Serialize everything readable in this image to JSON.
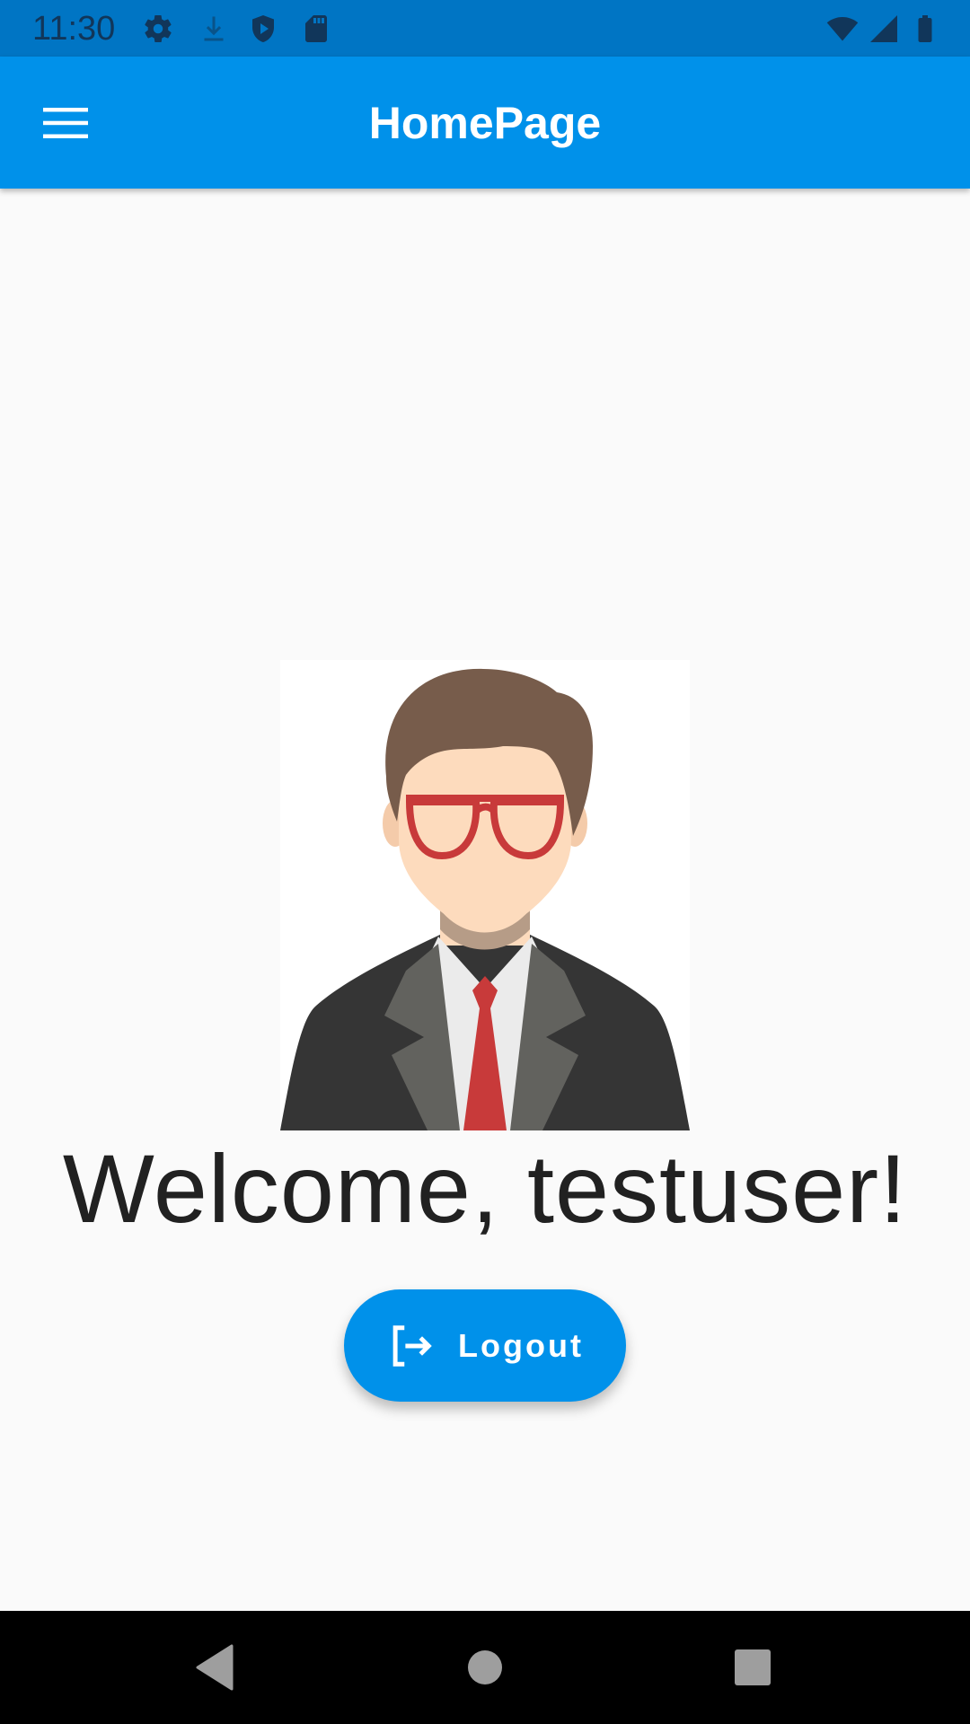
{
  "status_bar": {
    "time": "11:30",
    "left_icons": [
      "gear-icon",
      "download-icon",
      "shield-play-icon",
      "sd-card-icon"
    ],
    "right_icons": [
      "wifi-icon",
      "signal-icon",
      "battery-icon"
    ]
  },
  "app_bar": {
    "title": "HomePage",
    "menu_icon": "hamburger-menu-icon",
    "color": "#0091ea"
  },
  "main": {
    "avatar": "user-avatar-illustration",
    "welcome_text": "Welcome, testuser!",
    "logout_button": {
      "label": "Logout",
      "icon": "logout-icon",
      "color": "#0091ea"
    }
  },
  "nav_bar": {
    "buttons": [
      "back-icon",
      "home-icon",
      "recents-icon"
    ]
  },
  "colors": {
    "status_bar": "#0075c4",
    "background": "#fafafa",
    "text": "#212121"
  }
}
